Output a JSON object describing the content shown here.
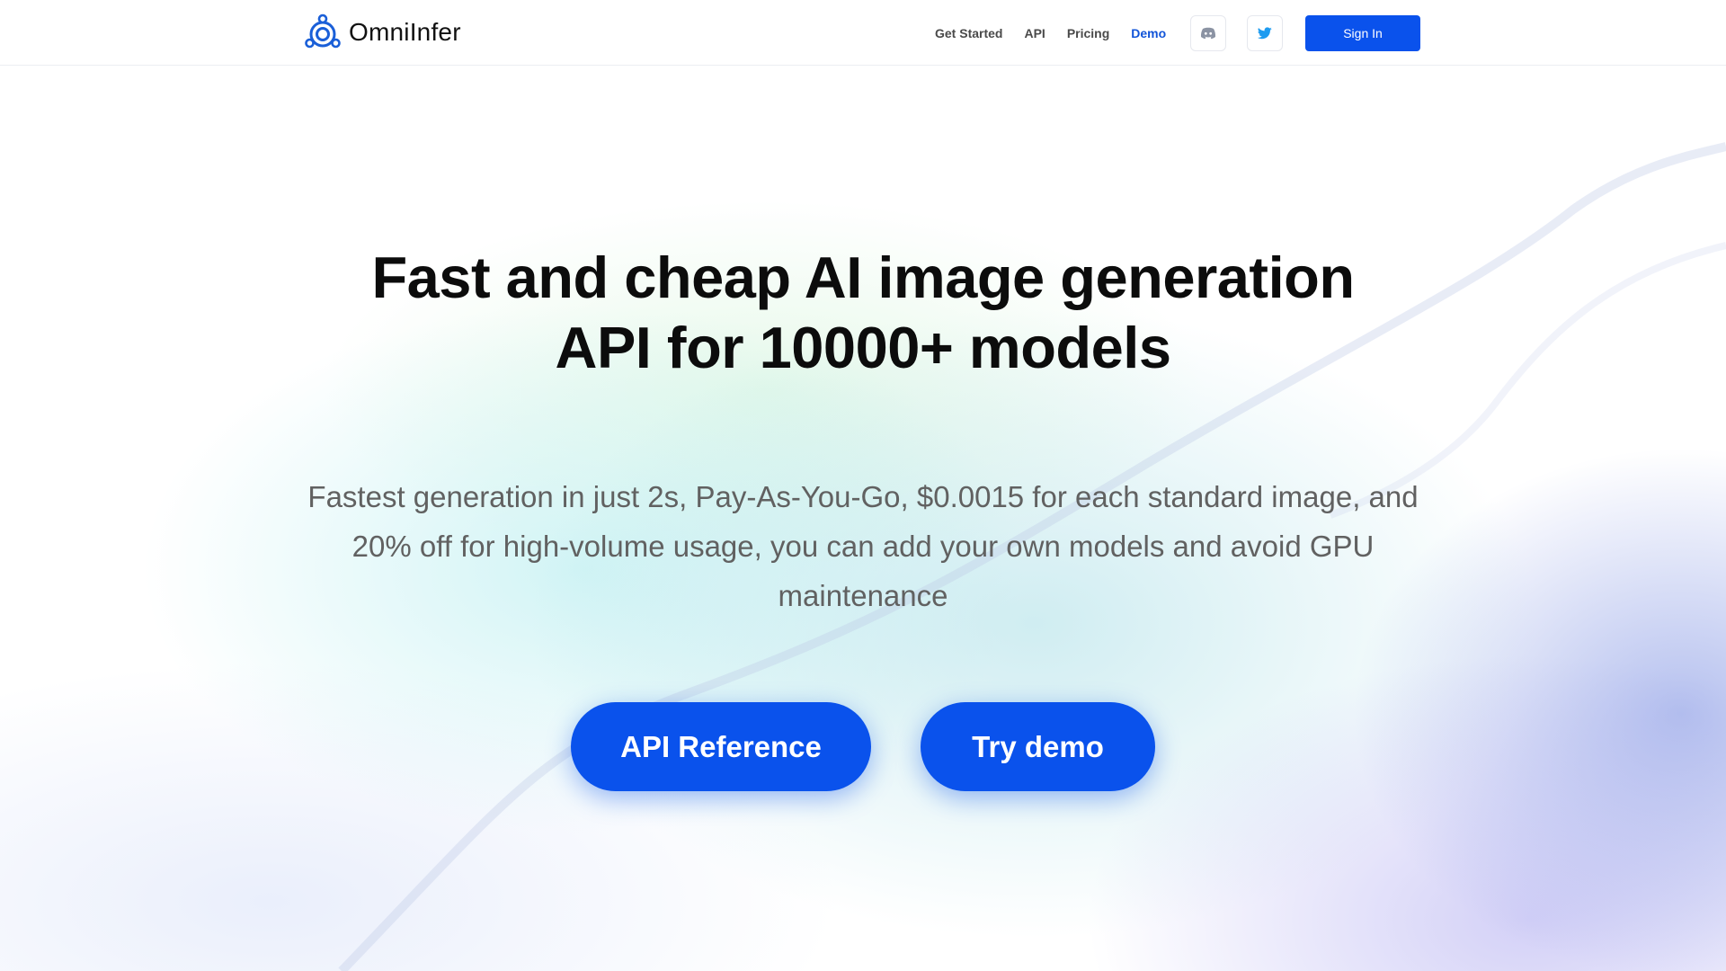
{
  "brand": {
    "name": "OmniInfer"
  },
  "nav": {
    "items": [
      {
        "label": "Get Started"
      },
      {
        "label": "API"
      },
      {
        "label": "Pricing"
      },
      {
        "label": "Demo"
      }
    ],
    "active": "Demo",
    "icons": [
      "discord-icon",
      "twitter-icon"
    ],
    "signin_label": "Sign In"
  },
  "hero": {
    "title_line1": "Fast and cheap AI image generation",
    "title_line2": "API for 10000+ models",
    "subtitle": "Fastest generation in just 2s, Pay-As-You-Go, $0.0015 for each standard image, and 20% off for high-volume usage, you can add your own models and avoid GPU maintenance",
    "cta_primary": "API Reference",
    "cta_secondary": "Try demo"
  },
  "colors": {
    "accent": "#0a52ec",
    "active_nav": "#1154d8",
    "twitter_blue": "#1d9bf0",
    "discord_gray": "#8b93a3"
  }
}
